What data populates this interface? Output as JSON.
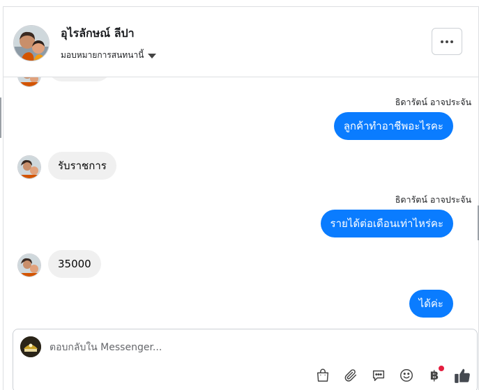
{
  "header": {
    "contact_name": "อุไรลักษณ์ ลีปา",
    "assign_label": "มอบหมายการสนทนานี้"
  },
  "messages": [
    {
      "direction": "out",
      "sender": "ธิดารัตน์ อาจประจัน",
      "text": "ลูกค้าทำอาชีพอะไรคะ"
    },
    {
      "direction": "in",
      "text": "รับราชการ"
    },
    {
      "direction": "out",
      "sender": "ธิดารัตน์ อาจประจัน",
      "text": "รายได้ต่อเดือนเท่าไหร่คะ"
    },
    {
      "direction": "in",
      "text": "35000"
    },
    {
      "direction": "out",
      "text": "ได้ค่ะ"
    }
  ],
  "composer": {
    "placeholder": "ตอบกลับใน Messenger...",
    "value": "",
    "payment_symbol": "฿"
  },
  "colors": {
    "outgoing_bubble": "#0a7cff",
    "incoming_bubble": "#f0f0f0",
    "notification_dot": "#e41e3f",
    "like_icon": "#444950"
  },
  "icons": [
    "more-icon",
    "caret-down-icon",
    "shopping-bag-icon",
    "paperclip-icon",
    "saved-reply-icon",
    "emoji-icon",
    "payment-icon",
    "thumbs-up-icon"
  ]
}
